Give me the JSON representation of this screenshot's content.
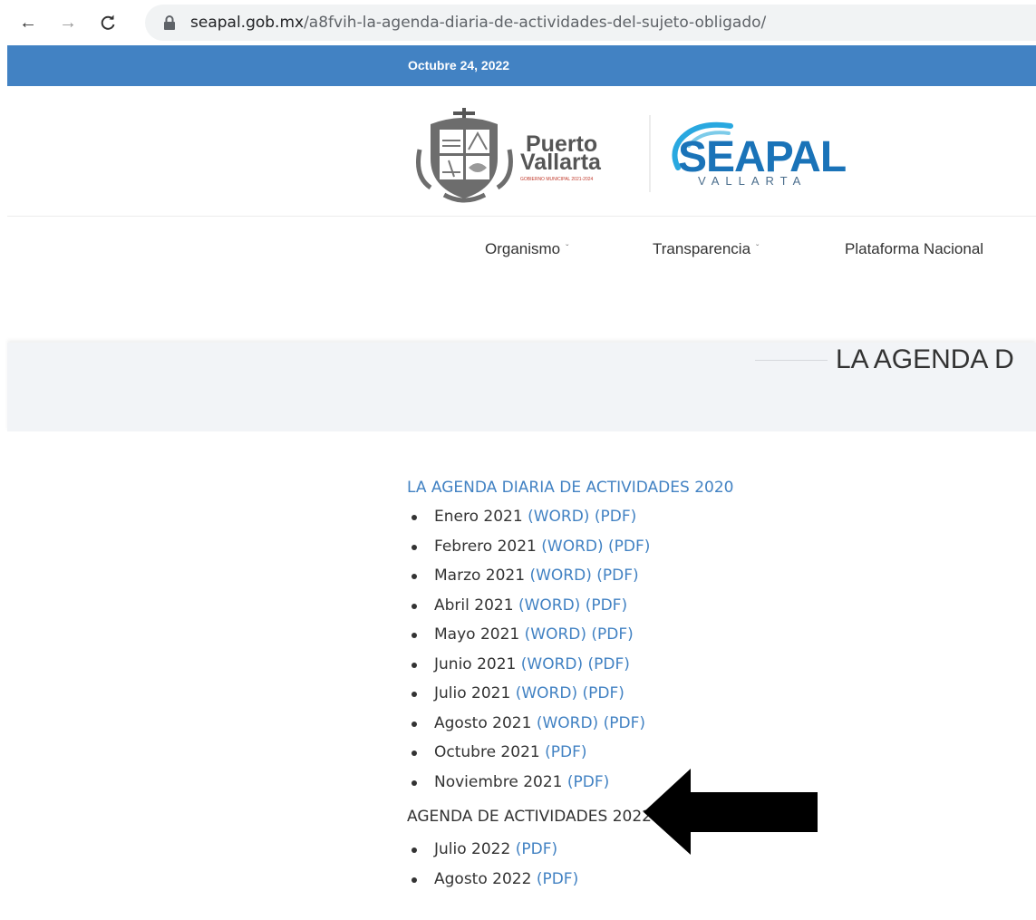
{
  "browser": {
    "back_icon": "arrow-left-icon",
    "forward_icon": "arrow-right-icon",
    "reload_icon": "reload-icon",
    "lock_icon": "lock-icon",
    "url_domain": "seapal.gob.mx",
    "url_path": "/a8fvih-la-agenda-diaria-de-actividades-del-sujeto-obligado/"
  },
  "header": {
    "date": "Octubre 24, 2022",
    "accent_color": "#4282c3"
  },
  "logos": {
    "pv_line1": "Puerto",
    "pv_line2": "Vallarta",
    "pv_sub": "GOBIERNO MUNICIPAL 2021-2024",
    "seapal": "SEAPAL",
    "seapal_sub": "VALLARTA"
  },
  "nav": {
    "items": [
      {
        "label": "Organismo"
      },
      {
        "label": "Transparencia"
      },
      {
        "label": "Plataforma Nacional"
      }
    ]
  },
  "banner": {
    "title": "LA AGENDA D"
  },
  "content": {
    "section1": "LA AGENDA DIARIA DE ACTIVIDADES 2020",
    "items1": [
      {
        "month": "Enero 2021",
        "word": "(WORD)",
        "pdf": "(PDF)"
      },
      {
        "month": "Febrero 2021",
        "word": "(WORD)",
        "pdf": "(PDF)"
      },
      {
        "month": "Marzo 2021",
        "word": "(WORD)",
        "pdf": "(PDF)"
      },
      {
        "month": "Abril 2021",
        "word": "(WORD)",
        "pdf": "(PDF)"
      },
      {
        "month": "Mayo 2021",
        "word": "(WORD)",
        "pdf": "(PDF)"
      },
      {
        "month": "Junio 2021",
        "word": "(WORD)",
        "pdf": "(PDF)"
      },
      {
        "month": "Julio 2021",
        "word": "(WORD)",
        "pdf": "(PDF)"
      },
      {
        "month": "Agosto 2021",
        "word": "(WORD)",
        "pdf": "(PDF)"
      },
      {
        "month": "Octubre 2021",
        "pdf": "(PDF)"
      },
      {
        "month": "Noviembre 2021",
        "pdf": "(PDF)"
      }
    ],
    "section2": "AGENDA DE ACTIVIDADES 2022",
    "items2": [
      {
        "month": "Julio 2022",
        "pdf": "(PDF)"
      },
      {
        "month": "Agosto 2022",
        "pdf": "(PDF)"
      }
    ]
  },
  "annotation": {
    "arrow_icon": "black-arrow-left-icon"
  }
}
